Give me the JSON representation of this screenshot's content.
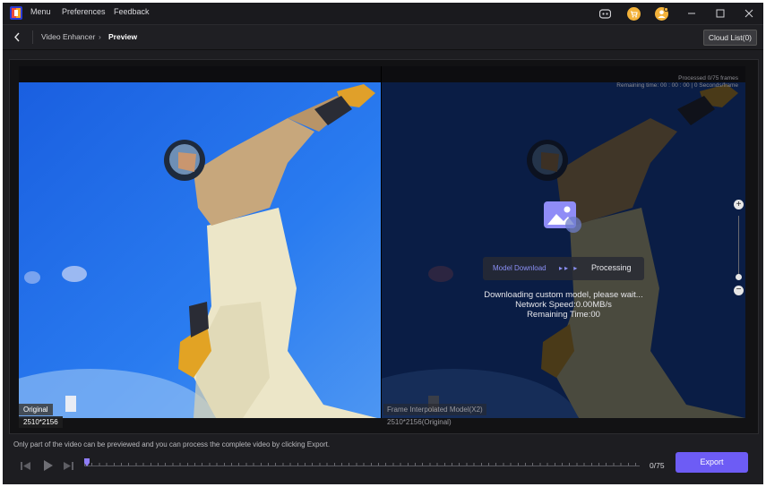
{
  "titlebar": {
    "menus": [
      "Menu",
      "Preferences",
      "Feedback"
    ],
    "icons": [
      "discord-icon",
      "cart-icon",
      "user-avatar-icon",
      "minimize-icon",
      "maximize-icon",
      "close-icon"
    ]
  },
  "nav": {
    "breadcrumb_parent": "Video Enhancer",
    "breadcrumb_current": "Preview",
    "cloud_list": "Cloud List(0)"
  },
  "preview": {
    "original_label": "Original",
    "original_size": "2510*2156",
    "model_label": "Frame Interpolated Model(X2)",
    "model_size": "2510*2156(Original)",
    "processed": "Processed 0/75 frames",
    "remaining": "Remaining time: 00 : 00 : 00 | 0 Seconds/frame",
    "steps": [
      "Model Download",
      "Processing"
    ],
    "download_msg": "Downloading custom model, please wait...",
    "network_speed": "Network Speed:0.00MB/s",
    "remaining_time": "Remaining Time:00"
  },
  "bottom": {
    "hint": "Only part of the video can be previewed and you can process the complete video by clicking Export.",
    "counter": "0/75",
    "export": "Export",
    "current_frame": 0,
    "total_frames": 75
  },
  "colors": {
    "accent": "#6d5cf5",
    "step_active": "#8a8ff5",
    "sky": "#1e6fe8"
  }
}
